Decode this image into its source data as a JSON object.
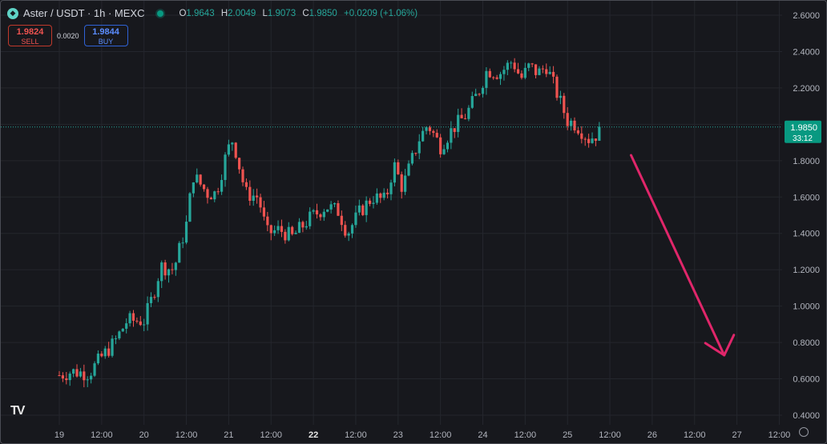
{
  "header": {
    "symbol": "Aster / USDT · 1h · MEXC",
    "open_label": "O",
    "open": "1.9643",
    "high_label": "H",
    "high": "2.0049",
    "low_label": "L",
    "low": "1.9073",
    "close_label": "C",
    "close": "1.9850",
    "change": "+0.0209 (+1.06%)"
  },
  "trade": {
    "sell_price": "1.9824",
    "sell_label": "SELL",
    "spread": "0.0020",
    "buy_price": "1.9844",
    "buy_label": "BUY"
  },
  "price_tag": {
    "price": "1.9850",
    "countdown": "33:12"
  },
  "colors": {
    "up": "#26a69a",
    "down": "#ef5350",
    "arrow": "#e0266a",
    "background": "#17181d"
  },
  "chart_data": {
    "type": "candlestick",
    "title": "Aster / USDT · 1h · MEXC",
    "ylim": [
      0.35,
      2.65
    ],
    "y_ticks": [
      "2.6000",
      "2.4000",
      "2.2000",
      "2.0000",
      "1.8000",
      "1.6000",
      "1.4000",
      "1.2000",
      "1.0000",
      "0.8000",
      "0.6000",
      "0.4000"
    ],
    "x_range_days": [
      0,
      8.9
    ],
    "x_ticks": [
      {
        "label": "19",
        "day": 0.0,
        "bold": false
      },
      {
        "label": "12:00",
        "day": 0.5,
        "bold": false
      },
      {
        "label": "20",
        "day": 1.0,
        "bold": false
      },
      {
        "label": "12:00",
        "day": 1.5,
        "bold": false
      },
      {
        "label": "21",
        "day": 2.0,
        "bold": false
      },
      {
        "label": "12:00",
        "day": 2.5,
        "bold": false
      },
      {
        "label": "22",
        "day": 3.0,
        "bold": true
      },
      {
        "label": "12:00",
        "day": 3.5,
        "bold": false
      },
      {
        "label": "23",
        "day": 4.0,
        "bold": false
      },
      {
        "label": "12:00",
        "day": 4.5,
        "bold": false
      },
      {
        "label": "24",
        "day": 5.0,
        "bold": false
      },
      {
        "label": "12:00",
        "day": 5.5,
        "bold": false
      },
      {
        "label": "25",
        "day": 6.0,
        "bold": false
      },
      {
        "label": "12:00",
        "day": 6.5,
        "bold": false
      },
      {
        "label": "26",
        "day": 7.0,
        "bold": false
      },
      {
        "label": "12:00",
        "day": 7.5,
        "bold": false
      },
      {
        "label": "27",
        "day": 8.0,
        "bold": false
      },
      {
        "label": "12:00",
        "day": 8.5,
        "bold": false
      }
    ],
    "close_path": [
      [
        0.0,
        0.62
      ],
      [
        0.15,
        0.64
      ],
      [
        0.35,
        0.63
      ],
      [
        0.5,
        0.72
      ],
      [
        0.65,
        0.8
      ],
      [
        0.8,
        0.92
      ],
      [
        1.0,
        0.92
      ],
      [
        1.1,
        1.05
      ],
      [
        1.2,
        1.22
      ],
      [
        1.35,
        1.2
      ],
      [
        1.5,
        1.45
      ],
      [
        1.58,
        1.72
      ],
      [
        1.75,
        1.62
      ],
      [
        1.85,
        1.62
      ],
      [
        1.98,
        1.85
      ],
      [
        2.05,
        1.92
      ],
      [
        2.1,
        1.82
      ],
      [
        2.2,
        1.62
      ],
      [
        2.35,
        1.6
      ],
      [
        2.45,
        1.4
      ],
      [
        2.6,
        1.42
      ],
      [
        2.75,
        1.38
      ],
      [
        2.95,
        1.48
      ],
      [
        3.15,
        1.55
      ],
      [
        3.3,
        1.52
      ],
      [
        3.4,
        1.4
      ],
      [
        3.55,
        1.52
      ],
      [
        3.7,
        1.6
      ],
      [
        3.85,
        1.58
      ],
      [
        3.95,
        1.78
      ],
      [
        4.05,
        1.65
      ],
      [
        4.25,
        1.92
      ],
      [
        4.35,
        2.0
      ],
      [
        4.5,
        1.88
      ],
      [
        4.65,
        1.98
      ],
      [
        4.8,
        2.05
      ],
      [
        4.95,
        2.18
      ],
      [
        5.05,
        2.3
      ],
      [
        5.2,
        2.28
      ],
      [
        5.35,
        2.35
      ],
      [
        5.45,
        2.25
      ],
      [
        5.55,
        2.32
      ],
      [
        5.65,
        2.28
      ],
      [
        5.75,
        2.32
      ],
      [
        5.85,
        2.2
      ],
      [
        6.0,
        2.02
      ],
      [
        6.1,
        2.0
      ],
      [
        6.25,
        1.92
      ],
      [
        6.4,
        1.96
      ]
    ],
    "last_price": 1.985,
    "arrow_days": [
      [
        6.75,
        1.83
      ],
      [
        7.85,
        0.73
      ]
    ]
  }
}
